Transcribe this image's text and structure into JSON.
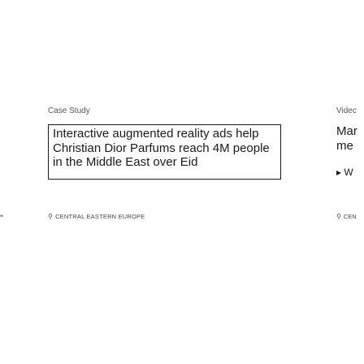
{
  "left_card": {
    "edge_glyph": "”"
  },
  "main_card": {
    "eyebrow": "Case Study",
    "headline": "Interactive augmented reality ads help Christian Dior Parfums reach 4M people in the Middle East over Eid",
    "location": "CENTRAL EASTERN EUROPE",
    "location_icon": "map-pin-icon"
  },
  "right_card": {
    "eyebrow": "Videc",
    "headline_line1": "Mar",
    "headline_line2": "me",
    "play_label": "▸ W",
    "location": "CEN",
    "location_icon": "map-pin-icon"
  }
}
